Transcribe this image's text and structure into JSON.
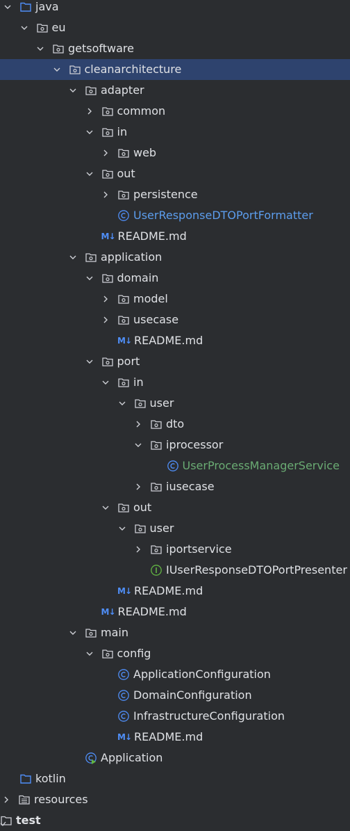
{
  "tree": {
    "nodes": [
      {
        "id": "java",
        "label": "java",
        "depth": 0,
        "chevron": "down",
        "icon": "source-folder-icon",
        "style": "normal"
      },
      {
        "id": "eu",
        "label": "eu",
        "depth": 1,
        "chevron": "down",
        "icon": "package-icon",
        "style": "normal"
      },
      {
        "id": "getsoftware",
        "label": "getsoftware",
        "depth": 2,
        "chevron": "down",
        "icon": "package-icon",
        "style": "normal"
      },
      {
        "id": "cleanarchitecture",
        "label": "cleanarchitecture",
        "depth": 3,
        "chevron": "down",
        "icon": "package-icon",
        "style": "normal",
        "selected": true
      },
      {
        "id": "adapter",
        "label": "adapter",
        "depth": 4,
        "chevron": "down",
        "icon": "package-icon",
        "style": "normal"
      },
      {
        "id": "adapter-common",
        "label": "common",
        "depth": 5,
        "chevron": "right",
        "icon": "package-icon",
        "style": "normal"
      },
      {
        "id": "adapter-in",
        "label": "in",
        "depth": 5,
        "chevron": "down",
        "icon": "package-icon",
        "style": "normal"
      },
      {
        "id": "adapter-in-web",
        "label": "web",
        "depth": 6,
        "chevron": "right",
        "icon": "package-icon",
        "style": "normal"
      },
      {
        "id": "adapter-out",
        "label": "out",
        "depth": 5,
        "chevron": "down",
        "icon": "package-icon",
        "style": "normal"
      },
      {
        "id": "adapter-out-persistence",
        "label": "persistence",
        "depth": 6,
        "chevron": "right",
        "icon": "package-icon",
        "style": "normal"
      },
      {
        "id": "adapter-out-formatter",
        "label": "UserResponseDTOPortFormatter",
        "depth": 6,
        "chevron": "none",
        "icon": "class-icon",
        "style": "blue"
      },
      {
        "id": "adapter-readme",
        "label": "README.md",
        "depth": 5,
        "chevron": "none",
        "icon": "markdown-icon",
        "style": "normal"
      },
      {
        "id": "application",
        "label": "application",
        "depth": 4,
        "chevron": "down",
        "icon": "package-icon",
        "style": "normal"
      },
      {
        "id": "domain",
        "label": "domain",
        "depth": 5,
        "chevron": "down",
        "icon": "package-icon",
        "style": "normal"
      },
      {
        "id": "domain-model",
        "label": "model",
        "depth": 6,
        "chevron": "right",
        "icon": "package-icon",
        "style": "normal"
      },
      {
        "id": "domain-usecase",
        "label": "usecase",
        "depth": 6,
        "chevron": "right",
        "icon": "package-icon",
        "style": "normal"
      },
      {
        "id": "domain-readme",
        "label": "README.md",
        "depth": 6,
        "chevron": "none",
        "icon": "markdown-icon",
        "style": "normal"
      },
      {
        "id": "port",
        "label": "port",
        "depth": 5,
        "chevron": "down",
        "icon": "package-icon",
        "style": "normal"
      },
      {
        "id": "port-in",
        "label": "in",
        "depth": 6,
        "chevron": "down",
        "icon": "package-icon",
        "style": "normal"
      },
      {
        "id": "port-in-user",
        "label": "user",
        "depth": 7,
        "chevron": "down",
        "icon": "package-icon",
        "style": "normal"
      },
      {
        "id": "port-in-user-dto",
        "label": "dto",
        "depth": 8,
        "chevron": "right",
        "icon": "package-icon",
        "style": "normal"
      },
      {
        "id": "port-in-user-iprocessor",
        "label": "iprocessor",
        "depth": 8,
        "chevron": "down",
        "icon": "package-icon",
        "style": "normal"
      },
      {
        "id": "user-process-manager",
        "label": "UserProcessManagerService",
        "depth": 9,
        "chevron": "none",
        "icon": "class-icon",
        "style": "green"
      },
      {
        "id": "port-in-user-iusecase",
        "label": "iusecase",
        "depth": 8,
        "chevron": "right",
        "icon": "package-icon",
        "style": "normal"
      },
      {
        "id": "port-out",
        "label": "out",
        "depth": 6,
        "chevron": "down",
        "icon": "package-icon",
        "style": "normal"
      },
      {
        "id": "port-out-user",
        "label": "user",
        "depth": 7,
        "chevron": "down",
        "icon": "package-icon",
        "style": "normal"
      },
      {
        "id": "port-out-user-iportservice",
        "label": "iportservice",
        "depth": 8,
        "chevron": "right",
        "icon": "package-icon",
        "style": "normal"
      },
      {
        "id": "iuser-presenter",
        "label": "IUserResponseDTOPortPresenter",
        "depth": 8,
        "chevron": "none",
        "icon": "interface-icon",
        "style": "normal"
      },
      {
        "id": "port-readme",
        "label": "README.md",
        "depth": 6,
        "chevron": "none",
        "icon": "markdown-icon",
        "style": "normal"
      },
      {
        "id": "application-readme",
        "label": "README.md",
        "depth": 5,
        "chevron": "none",
        "icon": "markdown-icon",
        "style": "normal"
      },
      {
        "id": "main",
        "label": "main",
        "depth": 4,
        "chevron": "down",
        "icon": "package-icon",
        "style": "normal"
      },
      {
        "id": "config",
        "label": "config",
        "depth": 5,
        "chevron": "down",
        "icon": "package-icon",
        "style": "normal"
      },
      {
        "id": "app-config",
        "label": "ApplicationConfiguration",
        "depth": 6,
        "chevron": "none",
        "icon": "class-icon",
        "style": "normal"
      },
      {
        "id": "domain-config",
        "label": "DomainConfiguration",
        "depth": 6,
        "chevron": "none",
        "icon": "class-icon",
        "style": "normal"
      },
      {
        "id": "infra-config",
        "label": "InfrastructureConfiguration",
        "depth": 6,
        "chevron": "none",
        "icon": "class-icon",
        "style": "normal"
      },
      {
        "id": "config-readme",
        "label": "README.md",
        "depth": 6,
        "chevron": "none",
        "icon": "markdown-icon",
        "style": "normal"
      },
      {
        "id": "application-class",
        "label": "Application",
        "depth": 4,
        "chevron": "none",
        "icon": "runnable-class-icon",
        "style": "normal"
      },
      {
        "id": "kotlin",
        "label": "kotlin",
        "depth": 0,
        "chevron": "none",
        "icon": "source-folder-icon",
        "style": "normal"
      },
      {
        "id": "resources",
        "label": "resources",
        "depth": 0,
        "chevron": "right",
        "icon": "resources-folder-icon",
        "style": "normal",
        "indent_override": "resources"
      },
      {
        "id": "test",
        "label": "test",
        "depth": 0,
        "chevron": "none",
        "icon": "test-folder-icon",
        "style": "bold",
        "indent_override": "test"
      }
    ],
    "markdown_icon_text": "M↓",
    "colors": {
      "background": "#2b2d30",
      "selected": "#2e436e",
      "text": "#dfe1e5",
      "blue_file": "#5c9ded",
      "green_file": "#6aab73",
      "class_icon": "#4f8ef7",
      "interface_icon": "#62b543",
      "folder_icon": "#ced0d6",
      "source_folder_icon": "#4f8ef7"
    }
  }
}
